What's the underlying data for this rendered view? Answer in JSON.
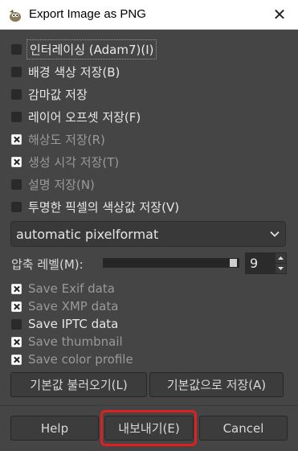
{
  "window": {
    "title": "Export Image as PNG",
    "close_glyph": "✕",
    "app_icon": "gimp-wilber-icon"
  },
  "options": [
    {
      "label": "인터레이싱 (Adam7)(I)",
      "checked": false,
      "enabled": true
    },
    {
      "label": "배경 색상 저장(B)",
      "checked": false,
      "enabled": true
    },
    {
      "label": "감마값 저장",
      "checked": false,
      "enabled": true
    },
    {
      "label": "레이어 오프셋 저장(F)",
      "checked": false,
      "enabled": true
    },
    {
      "label": "해상도 저장(R)",
      "checked": true,
      "enabled": false
    },
    {
      "label": "생성 시각 저장(T)",
      "checked": true,
      "enabled": false
    },
    {
      "label": "설명 저장(N)",
      "checked": false,
      "enabled": false
    },
    {
      "label": "투명한 픽셀의 색상값 저장(V)",
      "checked": false,
      "enabled": true
    }
  ],
  "pixelformat": {
    "value": "automatic pixelformat"
  },
  "compression": {
    "label": "압축 레벨(M):",
    "value": "9",
    "level_fraction": 1.0
  },
  "metadata": [
    {
      "label": "Save Exif data",
      "checked": true,
      "enabled": false
    },
    {
      "label": "Save XMP data",
      "checked": true,
      "enabled": false
    },
    {
      "label": "Save IPTC data",
      "checked": false,
      "enabled": true
    },
    {
      "label": "Save thumbnail",
      "checked": true,
      "enabled": false
    },
    {
      "label": "Save color profile",
      "checked": true,
      "enabled": false
    }
  ],
  "buttons": {
    "load_defaults": "기본값 불러오기(L)",
    "save_defaults": "기본값으로 저장(A)",
    "help": "Help",
    "export": "내보내기(E)",
    "cancel": "Cancel"
  },
  "colors": {
    "background": "#454545",
    "highlight": "#e02020"
  }
}
